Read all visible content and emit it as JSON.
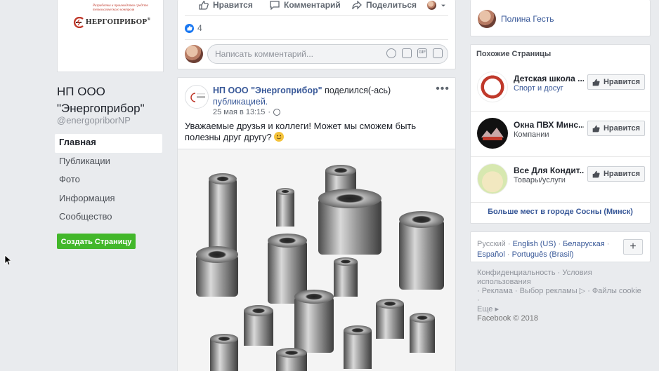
{
  "left": {
    "logo": {
      "tagline": "Разработка и производство средств технологического контроля",
      "word": "НЕРГОПРИБОР",
      "reg": "®"
    },
    "page_name": "НП ООО \"Энергоприбор\"",
    "handle": "@energopriborNP",
    "nav": [
      "Главная",
      "Публикации",
      "Фото",
      "Информация",
      "Сообщество"
    ],
    "create_button": "Создать Страницу"
  },
  "top_post": {
    "actions": {
      "like": "Нравится",
      "comment": "Комментарий",
      "share": "Поделиться"
    },
    "like_count": "4",
    "comment_placeholder": "Написать комментарий..."
  },
  "post": {
    "author": "НП ООО \"Энергоприбор\"",
    "shared": "поделился(-ась)",
    "link": "публикацией.",
    "time": "25 мая в 13:15",
    "dot": "·",
    "more": "•••",
    "text": "Уважаемые друзья и коллеги! Может мы сможем быть полезны друг другу?"
  },
  "right": {
    "friend_name": "Полина Гесть",
    "similar_title": "Похожие Страницы",
    "recs": [
      {
        "name": "Детская школа ...",
        "category": "Спорт и досуг",
        "button": "Нравится",
        "color": "#c0392b"
      },
      {
        "name": "Окна ПВХ Минс...",
        "category": "Компании",
        "button": "Нравится",
        "color": "#111111"
      },
      {
        "name": "Все Для Кондит...",
        "category": "Товары/услуги",
        "button": "Нравится",
        "color": "#e8e2b0"
      }
    ],
    "more_places": "Больше мест в городе Сосны (Минск)",
    "langs": {
      "ru": "Русский",
      "en": "English (US)",
      "by": "Беларуская",
      "es": "Español",
      "pt": "Português (Brasil)",
      "sep": "·"
    },
    "add_lang": "+",
    "footer": {
      "line1": "Конфиденциальность · Условия использования",
      "line2": "· Реклама · Выбор рекламы ▷ · Файлы cookie ·",
      "line3": "Еще ▸",
      "copyright": "Facebook © 2018"
    }
  },
  "colors": {
    "brand_link": "#385898",
    "create_green": "#42b72a",
    "like_blue": "#1877f2",
    "background": "#e9ebee"
  }
}
